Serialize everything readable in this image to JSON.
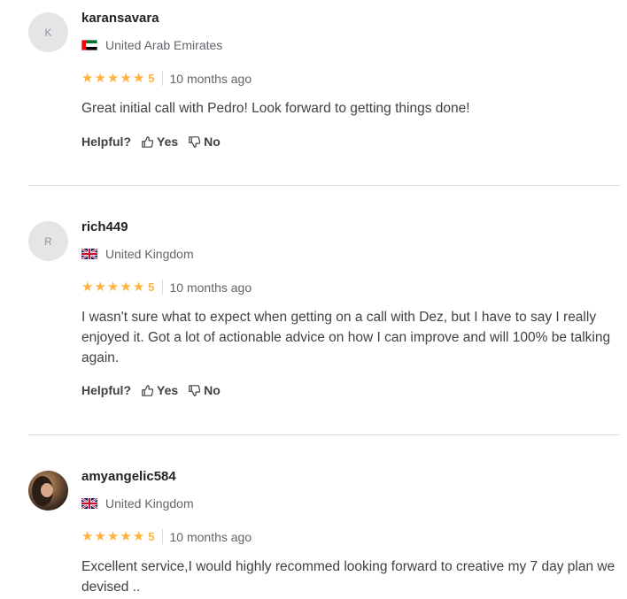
{
  "reviews": [
    {
      "avatar_letter": "K",
      "username": "karansavara",
      "country": "United Arab Emirates",
      "flag": "uae",
      "stars": 5,
      "score": "5",
      "time": "10 months ago",
      "text": "Great initial call with Pedro! Look forward to getting things done!",
      "helpful_label": "Helpful?",
      "yes_label": "Yes",
      "no_label": "No"
    },
    {
      "avatar_letter": "R",
      "username": "rich449",
      "country": "United Kingdom",
      "flag": "uk",
      "stars": 5,
      "score": "5",
      "time": "10 months ago",
      "text": "I wasn't sure what to expect when getting on a call with Dez, but I have to say I really enjoyed it. Got a lot of actionable advice on how I can improve and will 100% be talking again.",
      "helpful_label": "Helpful?",
      "yes_label": "Yes",
      "no_label": "No"
    },
    {
      "avatar_letter": "",
      "username": "amyangelic584",
      "country": "United Kingdom",
      "flag": "uk",
      "stars": 5,
      "score": "5",
      "time": "10 months ago",
      "text": "Excellent service,I would highly recommed looking forward to creative my 7 day plan we devised .."
    }
  ],
  "colors": {
    "star": "#ffb33e",
    "divider": "#dadbdd",
    "avatar_bg": "#e4e5e7"
  },
  "icons": {
    "star": "star-icon",
    "thumb_up": "thumbs-up-icon",
    "thumb_down": "thumbs-down-icon"
  }
}
